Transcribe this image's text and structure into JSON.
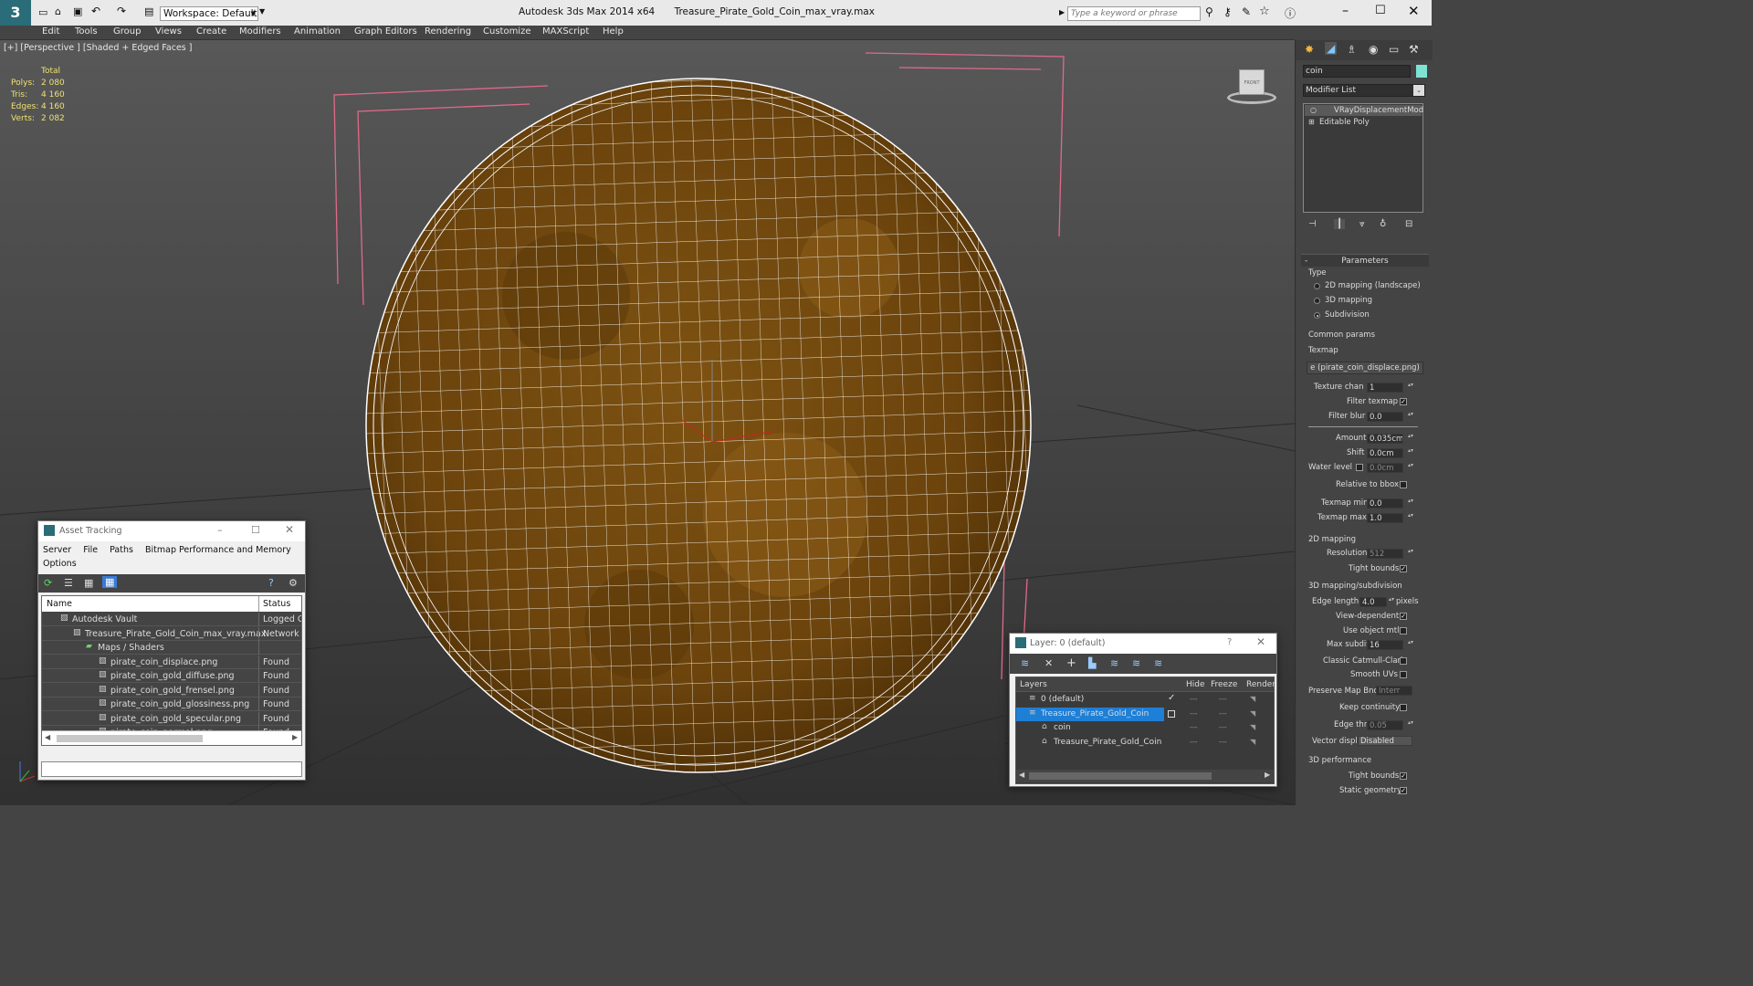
{
  "titlebar": {
    "app": "Autodesk 3ds Max  2014 x64",
    "file": "Treasure_Pirate_Gold_Coin_max_vray.max",
    "workspace": "Workspace: Default",
    "search_placeholder": "Type a keyword or phrase"
  },
  "menu": [
    "Edit",
    "Tools",
    "Group",
    "Views",
    "Create",
    "Modifiers",
    "Animation",
    "Graph Editors",
    "Rendering",
    "Customize",
    "MAXScript",
    "Help"
  ],
  "viewport": {
    "label": "[+] [Perspective ] [Shaded + Edged Faces ]",
    "stats": {
      "header": "Total",
      "rows": [
        [
          "Polys:",
          "2 080"
        ],
        [
          "Tris:",
          "4 160"
        ],
        [
          "Edges:",
          "4 160"
        ],
        [
          "Verts:",
          "2 082"
        ]
      ]
    }
  },
  "cube_label": "FRONT",
  "command_panel": {
    "object_name": "coin",
    "modifier_list": "Modifier List",
    "stack": [
      "VRayDisplacementMod",
      "Editable Poly"
    ],
    "rollout": "Parameters",
    "type_label": "Type",
    "type_options": [
      "2D mapping (landscape)",
      "3D mapping",
      "Subdivision"
    ],
    "common_params": "Common params",
    "texmap_label": "Texmap",
    "texmap_value": "e (pirate_coin_displace.png)",
    "texture_chan": {
      "label": "Texture chan",
      "value": "1"
    },
    "filter_texmap": "Filter texmap",
    "filter_blur": {
      "label": "Filter blur",
      "value": "0.0"
    },
    "amount": {
      "label": "Amount",
      "value": "0.035cm"
    },
    "shift": {
      "label": "Shift",
      "value": "0.0cm"
    },
    "water_level": {
      "label": "Water level",
      "value": "0.0cm"
    },
    "relative_bbox": "Relative to bbox",
    "texmap_min": {
      "label": "Texmap min",
      "value": "0.0"
    },
    "texmap_max": {
      "label": "Texmap max",
      "value": "1.0"
    },
    "mapping2d": "2D mapping",
    "resolution": {
      "label": "Resolution",
      "value": "512"
    },
    "tight_bounds": "Tight bounds",
    "mapping3d": "3D mapping/subdivision",
    "edge_length": {
      "label": "Edge length",
      "value": "4.0",
      "unit": "pixels"
    },
    "view_dependent": "View-dependent",
    "use_object_mtl": "Use object mtl",
    "max_subdivs": {
      "label": "Max subdivs",
      "value": "16"
    },
    "classic_catmull": "Classic Catmull-Clark",
    "smooth_uvs": "Smooth UVs",
    "preserve_map": {
      "label": "Preserve Map Bnd",
      "value": "Interr"
    },
    "keep_continuity": "Keep continuity",
    "edge_thresh": {
      "label": "Edge thresh",
      "value": "0.05"
    },
    "vector_displ": {
      "label": "Vector displ",
      "value": "Disabled"
    },
    "perf": "3D performance",
    "tight_bounds2": "Tight bounds",
    "static_geometry": "Static geometry"
  },
  "asset_tracking": {
    "title": "Asset Tracking",
    "menu": [
      "Server",
      "File",
      "Paths",
      "Bitmap Performance and Memory"
    ],
    "menu2": "Options",
    "columns": [
      "Name",
      "Status"
    ],
    "rows": [
      {
        "name": "Autodesk Vault",
        "status": "Logged O",
        "indent": 0
      },
      {
        "name": "Treasure_Pirate_Gold_Coin_max_vray.max",
        "status": "Network F",
        "indent": 1
      },
      {
        "name": "Maps / Shaders",
        "status": "",
        "indent": 2
      },
      {
        "name": "pirate_coin_displace.png",
        "status": "Found",
        "indent": 3
      },
      {
        "name": "pirate_coin_gold_diffuse.png",
        "status": "Found",
        "indent": 3
      },
      {
        "name": "pirate_coin_gold_frensel.png",
        "status": "Found",
        "indent": 3
      },
      {
        "name": "pirate_coin_gold_glossiness.png",
        "status": "Found",
        "indent": 3
      },
      {
        "name": "pirate_coin_gold_specular.png",
        "status": "Found",
        "indent": 3
      },
      {
        "name": "pirate_coin_normal.png",
        "status": "Found",
        "indent": 3
      }
    ]
  },
  "layer_window": {
    "title": "Layer: 0 (default)",
    "help": "?",
    "columns": [
      "Layers",
      "Hide",
      "Freeze",
      "Render"
    ],
    "rows": [
      {
        "name": "0 (default)",
        "selected": false,
        "indent": 0
      },
      {
        "name": "Treasure_Pirate_Gold_Coin",
        "selected": true,
        "indent": 0
      },
      {
        "name": "coin",
        "selected": false,
        "indent": 1
      },
      {
        "name": "Treasure_Pirate_Gold_Coin",
        "selected": false,
        "indent": 1
      }
    ]
  },
  "colors": {
    "accent": "#3399ff",
    "selection": "#1e7fd6",
    "coin": "#7a4f10",
    "wire": "#ffffff",
    "bbox": "#e06a8a"
  }
}
